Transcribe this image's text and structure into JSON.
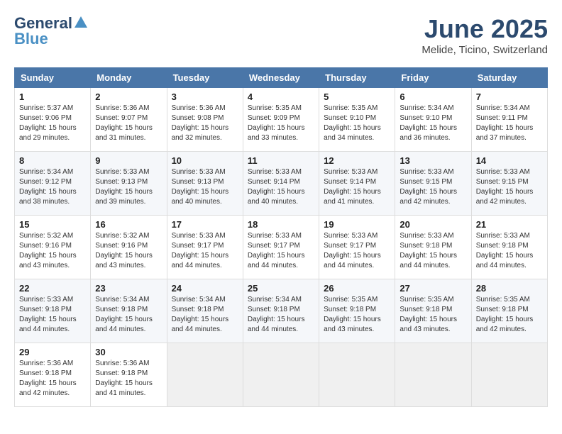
{
  "logo": {
    "general": "General",
    "blue": "Blue"
  },
  "title": "June 2025",
  "location": "Melide, Ticino, Switzerland",
  "days_of_week": [
    "Sunday",
    "Monday",
    "Tuesday",
    "Wednesday",
    "Thursday",
    "Friday",
    "Saturday"
  ],
  "weeks": [
    [
      {
        "day": "1",
        "sunrise": "5:37 AM",
        "sunset": "9:06 PM",
        "daylight": "15 hours and 29 minutes."
      },
      {
        "day": "2",
        "sunrise": "5:36 AM",
        "sunset": "9:07 PM",
        "daylight": "15 hours and 31 minutes."
      },
      {
        "day": "3",
        "sunrise": "5:36 AM",
        "sunset": "9:08 PM",
        "daylight": "15 hours and 32 minutes."
      },
      {
        "day": "4",
        "sunrise": "5:35 AM",
        "sunset": "9:09 PM",
        "daylight": "15 hours and 33 minutes."
      },
      {
        "day": "5",
        "sunrise": "5:35 AM",
        "sunset": "9:10 PM",
        "daylight": "15 hours and 34 minutes."
      },
      {
        "day": "6",
        "sunrise": "5:34 AM",
        "sunset": "9:10 PM",
        "daylight": "15 hours and 36 minutes."
      },
      {
        "day": "7",
        "sunrise": "5:34 AM",
        "sunset": "9:11 PM",
        "daylight": "15 hours and 37 minutes."
      }
    ],
    [
      {
        "day": "8",
        "sunrise": "5:34 AM",
        "sunset": "9:12 PM",
        "daylight": "15 hours and 38 minutes."
      },
      {
        "day": "9",
        "sunrise": "5:33 AM",
        "sunset": "9:13 PM",
        "daylight": "15 hours and 39 minutes."
      },
      {
        "day": "10",
        "sunrise": "5:33 AM",
        "sunset": "9:13 PM",
        "daylight": "15 hours and 40 minutes."
      },
      {
        "day": "11",
        "sunrise": "5:33 AM",
        "sunset": "9:14 PM",
        "daylight": "15 hours and 40 minutes."
      },
      {
        "day": "12",
        "sunrise": "5:33 AM",
        "sunset": "9:14 PM",
        "daylight": "15 hours and 41 minutes."
      },
      {
        "day": "13",
        "sunrise": "5:33 AM",
        "sunset": "9:15 PM",
        "daylight": "15 hours and 42 minutes."
      },
      {
        "day": "14",
        "sunrise": "5:33 AM",
        "sunset": "9:15 PM",
        "daylight": "15 hours and 42 minutes."
      }
    ],
    [
      {
        "day": "15",
        "sunrise": "5:32 AM",
        "sunset": "9:16 PM",
        "daylight": "15 hours and 43 minutes."
      },
      {
        "day": "16",
        "sunrise": "5:32 AM",
        "sunset": "9:16 PM",
        "daylight": "15 hours and 43 minutes."
      },
      {
        "day": "17",
        "sunrise": "5:33 AM",
        "sunset": "9:17 PM",
        "daylight": "15 hours and 44 minutes."
      },
      {
        "day": "18",
        "sunrise": "5:33 AM",
        "sunset": "9:17 PM",
        "daylight": "15 hours and 44 minutes."
      },
      {
        "day": "19",
        "sunrise": "5:33 AM",
        "sunset": "9:17 PM",
        "daylight": "15 hours and 44 minutes."
      },
      {
        "day": "20",
        "sunrise": "5:33 AM",
        "sunset": "9:18 PM",
        "daylight": "15 hours and 44 minutes."
      },
      {
        "day": "21",
        "sunrise": "5:33 AM",
        "sunset": "9:18 PM",
        "daylight": "15 hours and 44 minutes."
      }
    ],
    [
      {
        "day": "22",
        "sunrise": "5:33 AM",
        "sunset": "9:18 PM",
        "daylight": "15 hours and 44 minutes."
      },
      {
        "day": "23",
        "sunrise": "5:34 AM",
        "sunset": "9:18 PM",
        "daylight": "15 hours and 44 minutes."
      },
      {
        "day": "24",
        "sunrise": "5:34 AM",
        "sunset": "9:18 PM",
        "daylight": "15 hours and 44 minutes."
      },
      {
        "day": "25",
        "sunrise": "5:34 AM",
        "sunset": "9:18 PM",
        "daylight": "15 hours and 44 minutes."
      },
      {
        "day": "26",
        "sunrise": "5:35 AM",
        "sunset": "9:18 PM",
        "daylight": "15 hours and 43 minutes."
      },
      {
        "day": "27",
        "sunrise": "5:35 AM",
        "sunset": "9:18 PM",
        "daylight": "15 hours and 43 minutes."
      },
      {
        "day": "28",
        "sunrise": "5:35 AM",
        "sunset": "9:18 PM",
        "daylight": "15 hours and 42 minutes."
      }
    ],
    [
      {
        "day": "29",
        "sunrise": "5:36 AM",
        "sunset": "9:18 PM",
        "daylight": "15 hours and 42 minutes."
      },
      {
        "day": "30",
        "sunrise": "5:36 AM",
        "sunset": "9:18 PM",
        "daylight": "15 hours and 41 minutes."
      },
      null,
      null,
      null,
      null,
      null
    ]
  ]
}
